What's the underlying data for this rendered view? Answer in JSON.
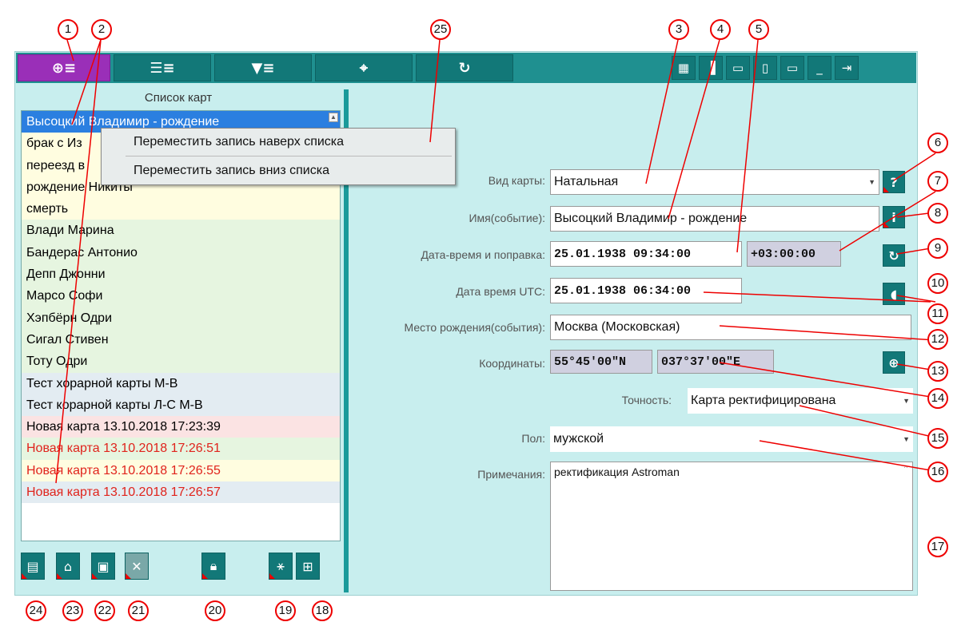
{
  "list": {
    "title": "Список карт",
    "items": [
      {
        "label": "Высоцкий Владимир - рождение"
      },
      {
        "label": "брак с Из"
      },
      {
        "label": "переезд в"
      },
      {
        "label": "рождение Никиты"
      },
      {
        "label": "смерть"
      },
      {
        "label": "Влади Марина"
      },
      {
        "label": "Бандерас Антонио"
      },
      {
        "label": "Депп Джонни"
      },
      {
        "label": "Марсо Софи"
      },
      {
        "label": "Хэпбёрн Одри"
      },
      {
        "label": "Сигал Стивен"
      },
      {
        "label": "Тоту Одри"
      },
      {
        "label": "Тест хорарной карты М-В"
      },
      {
        "label": "Тест корарной карты Л-С М-В"
      },
      {
        "label": "Новая карта 13.10.2018 17:23:39"
      },
      {
        "label": "Новая карта 13.10.2018 17:26:51"
      },
      {
        "label": "Новая карта 13.10.2018 17:26:55"
      },
      {
        "label": "Новая карта 13.10.2018 17:26:57"
      }
    ]
  },
  "context_menu": {
    "move_top": "Переместить запись наверх списка",
    "move_bottom": "Переместить запись вниз списка"
  },
  "form": {
    "chart_type_label": "Вид карты:",
    "chart_type_value": "Натальная",
    "name_label": "Имя(событие):",
    "name_value": "Высоцкий Владимир - рождение",
    "datetime_label": "Дата-время и поправка:",
    "datetime_value": "25.01.1938 09:34:00",
    "offset_value": "+03:00:00",
    "utc_label": "Дата время UTC:",
    "utc_value": "25.01.1938 06:34:00",
    "place_label": "Место рождения(события):",
    "place_value": "Москва (Московская)",
    "coords_label": "Координаты:",
    "lat_value": "55°45'00\"N",
    "lon_value": "037°37'00\"E",
    "accuracy_label": "Точность:",
    "accuracy_value": "Карта ректифицирована",
    "sex_label": "Пол:",
    "sex_value": "мужской",
    "notes_label": "Примечания:",
    "notes_value": "ректификация Astroman"
  },
  "callouts": [
    "1",
    "2",
    "3",
    "4",
    "5",
    "6",
    "7",
    "8",
    "9",
    "10",
    "11",
    "12",
    "13",
    "14",
    "15",
    "16",
    "17",
    "18",
    "19",
    "20",
    "21",
    "22",
    "23",
    "24",
    "25"
  ],
  "icons": {
    "toolbar": [
      "crosshair-list-icon",
      "database-list-icon",
      "filter-list-icon",
      "crosshair-icon",
      "refresh-icon"
    ],
    "window": [
      "grid-icon",
      "panel-left-icon",
      "panel-bottom-icon",
      "panel-right-icon",
      "panel-top-icon",
      "minimize-icon",
      "exit-icon"
    ],
    "bottom": [
      "new-file-icon",
      "open-folder-icon",
      "save-icon",
      "delete-icon",
      "lock-icon",
      "tree-icon",
      "table-icon"
    ],
    "right": [
      "help-icon",
      "info-icon",
      "refresh-icon",
      "pointer-icon",
      "globe-icon"
    ]
  },
  "colors": {
    "accent": "#1f9090",
    "active_tab": "#9a2fb8",
    "selection": "#2b7fe0",
    "callout": "#e00000"
  }
}
